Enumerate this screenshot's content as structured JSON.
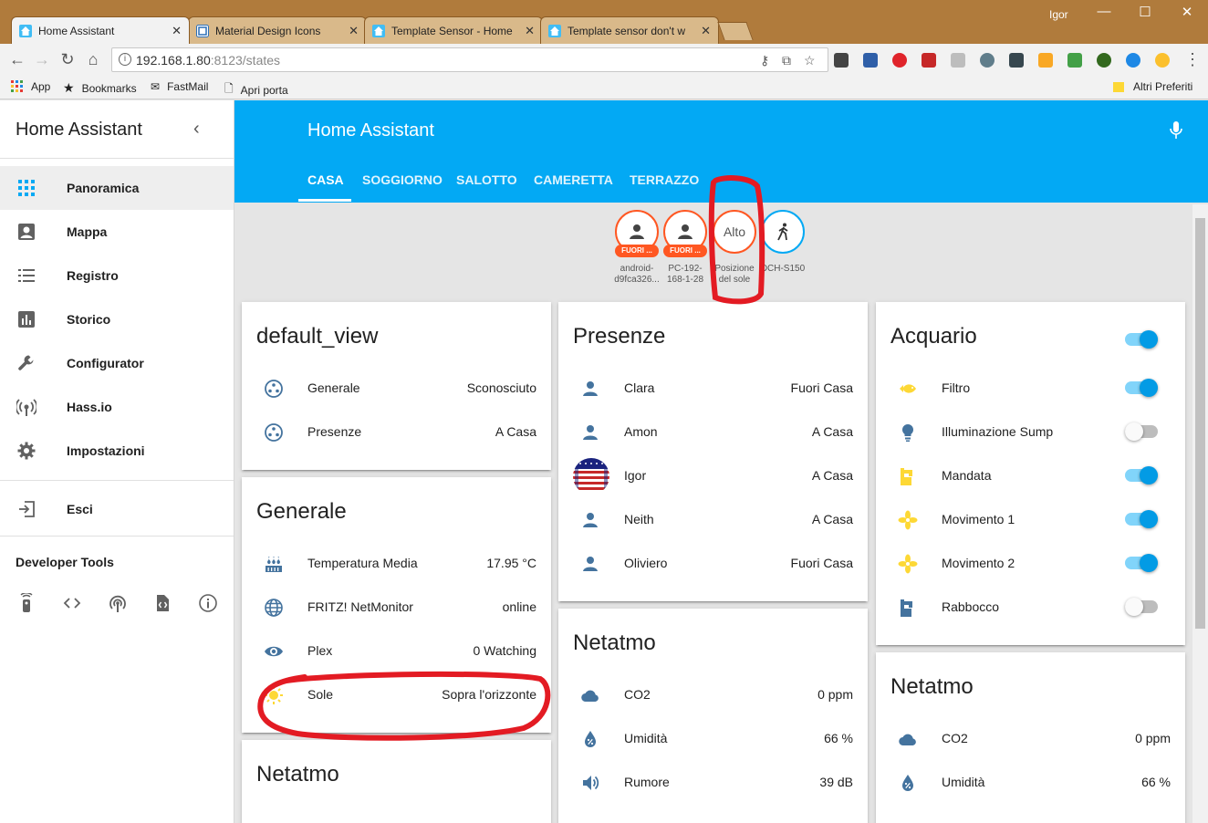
{
  "browser": {
    "user": "Igor",
    "tabs": [
      {
        "title": "Home Assistant",
        "active": true
      },
      {
        "title": "Material Design Icons",
        "active": false
      },
      {
        "title": "Template Sensor - Home",
        "active": false
      },
      {
        "title": "Template sensor don't w",
        "active": false
      }
    ],
    "url_host": "192.168.1.80",
    "url_rest": ":8123/states",
    "bookmarks": [
      "App",
      "Bookmarks",
      "FastMail",
      "Apri porta"
    ],
    "other_bookmarks": "Altri Preferiti"
  },
  "sidebar": {
    "title": "Home Assistant",
    "items": [
      {
        "label": "Panoramica",
        "icon": "grid-icon"
      },
      {
        "label": "Mappa",
        "icon": "account-box-icon"
      },
      {
        "label": "Registro",
        "icon": "list-icon"
      },
      {
        "label": "Storico",
        "icon": "chart-icon"
      },
      {
        "label": "Configurator",
        "icon": "wrench-icon"
      },
      {
        "label": "Hass.io",
        "icon": "broadcast-icon"
      },
      {
        "label": "Impostazioni",
        "icon": "gear-icon"
      }
    ],
    "logout": "Esci",
    "dev_tools_title": "Developer Tools"
  },
  "header": {
    "title": "Home Assistant",
    "tabs": [
      "CASA",
      "SOGGIORNO",
      "SALOTTO",
      "CAMERETTA",
      "TERRAZZO"
    ]
  },
  "badges": [
    {
      "pill": "FUORI ...",
      "label_1": "android-",
      "label_2": "d9fca326..."
    },
    {
      "pill": "FUORI ...",
      "label_1": "PC-192-",
      "label_2": "168-1-28"
    },
    {
      "text": "Alto",
      "label_1": "Posizione",
      "label_2": "del sole"
    },
    {
      "label_1": "DCH-S150",
      "label_2": ""
    }
  ],
  "cards": {
    "default_view": {
      "title": "default_view",
      "rows": [
        {
          "name": "Generale",
          "value": "Sconosciuto"
        },
        {
          "name": "Presenze",
          "value": "A Casa"
        }
      ]
    },
    "generale": {
      "title": "Generale",
      "rows": [
        {
          "name": "Temperatura Media",
          "value": "17.95 °C"
        },
        {
          "name": "FRITZ! NetMonitor",
          "value": "online"
        },
        {
          "name": "Plex",
          "value": "0 Watching"
        },
        {
          "name": "Sole",
          "value": "Sopra l'orizzonte"
        }
      ]
    },
    "netatmo_left": {
      "title": "Netatmo"
    },
    "presenze": {
      "title": "Presenze",
      "rows": [
        {
          "name": "Clara",
          "value": "Fuori Casa"
        },
        {
          "name": "Amon",
          "value": "A Casa"
        },
        {
          "name": "Igor",
          "value": "A Casa"
        },
        {
          "name": "Neith",
          "value": "A Casa"
        },
        {
          "name": "Oliviero",
          "value": "Fuori Casa"
        }
      ]
    },
    "netatmo_mid": {
      "title": "Netatmo",
      "rows": [
        {
          "name": "CO2",
          "value": "0 ppm"
        },
        {
          "name": "Umidità",
          "value": "66 %"
        },
        {
          "name": "Rumore",
          "value": "39 dB"
        }
      ]
    },
    "acquario": {
      "title": "Acquario",
      "master_on": true,
      "rows": [
        {
          "name": "Filtro",
          "on": true
        },
        {
          "name": "Illuminazione Sump",
          "on": false
        },
        {
          "name": "Mandata",
          "on": true
        },
        {
          "name": "Movimento 1",
          "on": true
        },
        {
          "name": "Movimento 2",
          "on": true
        },
        {
          "name": "Rabbocco",
          "on": false
        }
      ]
    },
    "netatmo_right": {
      "title": "Netatmo",
      "rows": [
        {
          "name": "CO2",
          "value": "0 ppm"
        },
        {
          "name": "Umidità",
          "value": "66 %"
        }
      ]
    }
  },
  "colors": {
    "primary": "#03a9f4",
    "icon": "#44739e",
    "yellow": "#fdd835",
    "badge_orange": "#ff5722",
    "annotation": "#e31b23"
  }
}
